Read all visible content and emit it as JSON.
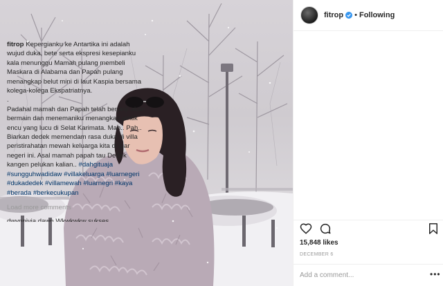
{
  "post": {
    "username": "fitrop",
    "follow_label": "Following",
    "dot": "•",
    "caption": {
      "username": "fitrop",
      "paragraph1": "Kepergianku ke Antartika ini adalah wujud duka, bete serta ekspresi kesepianku kala menunggu Mamah pulang membeli Maskara di Alabama dan Papah pulang menangkap belut mini di laut Kaspia bersama kolega-kolega Ekspatriatnya.",
      "separator": ".",
      "paragraph2": "Padahal mamah dan Papah telah berjanji akan bermain dan menemaniku menangkap jentik encu yang lucu di Selat Karimata. Mah.. Pah.. Biarkan dedek memendam rasa duka di villa peristirahatan mewah keluarga kita di luar negeri ini. Asal mamah papah tau Dedek kangen pelukan kalian..",
      "hashtags": [
        "#dahgituaja",
        "#sungguhwadidaw",
        "#villakeluarga",
        "#luarnegeri",
        "#dukadedek",
        "#villamewah",
        "#luarnegri",
        "#kaya",
        "#berada",
        "#berkecukupan"
      ]
    },
    "load_more_label": "Load more comments",
    "partial_comment": "dwynnivia dawn Wkwkwkw sukses",
    "likes": "15,848 likes",
    "date": "DECEMBER 6",
    "comment_placeholder": "Add a comment...",
    "more_label": "•••"
  },
  "icons": {
    "avatar": "avatar",
    "verified": "verified-badge-icon",
    "like": "heart-icon",
    "comment": "comment-icon",
    "save": "bookmark-icon"
  },
  "colors": {
    "hashtag": "#003569",
    "verified": "#3897f0",
    "muted": "#999999",
    "text": "#262626"
  }
}
